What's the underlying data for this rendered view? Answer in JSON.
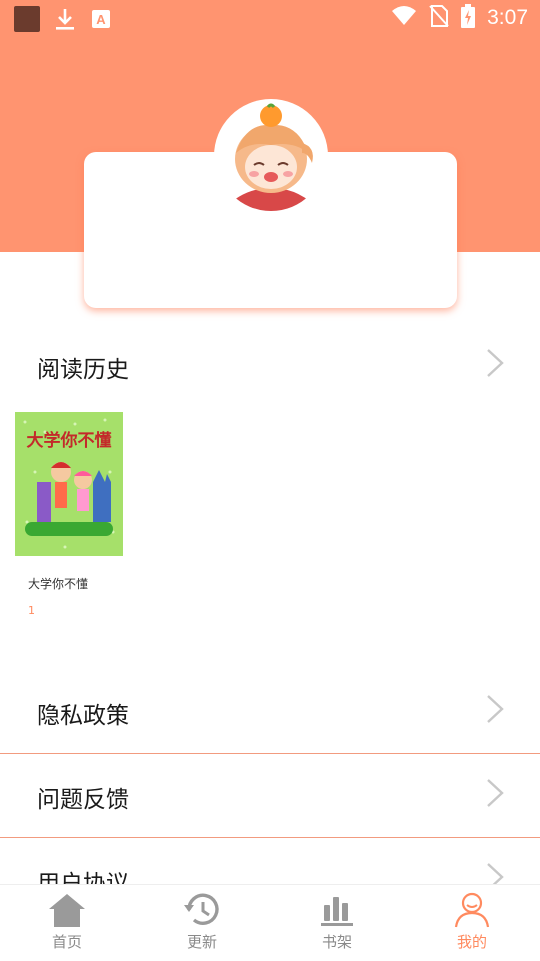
{
  "status_bar": {
    "time": "3:07"
  },
  "history": {
    "title": "阅读历史"
  },
  "book": {
    "title": "大学你不懂",
    "progress": "1",
    "cover_title": "大学你不懂"
  },
  "menu": [
    {
      "label": "隐私政策"
    },
    {
      "label": "问题反馈"
    },
    {
      "label": "用户协议"
    }
  ],
  "nav": [
    {
      "label": "首页",
      "icon": "home-icon"
    },
    {
      "label": "更新",
      "icon": "history-icon"
    },
    {
      "label": "书架",
      "icon": "bookshelf-icon"
    },
    {
      "label": "我的",
      "icon": "user-icon",
      "active": true
    }
  ],
  "colors": {
    "accent": "#ff9470",
    "divider": "#f29b7f",
    "inactive": "#8a8a8a"
  }
}
